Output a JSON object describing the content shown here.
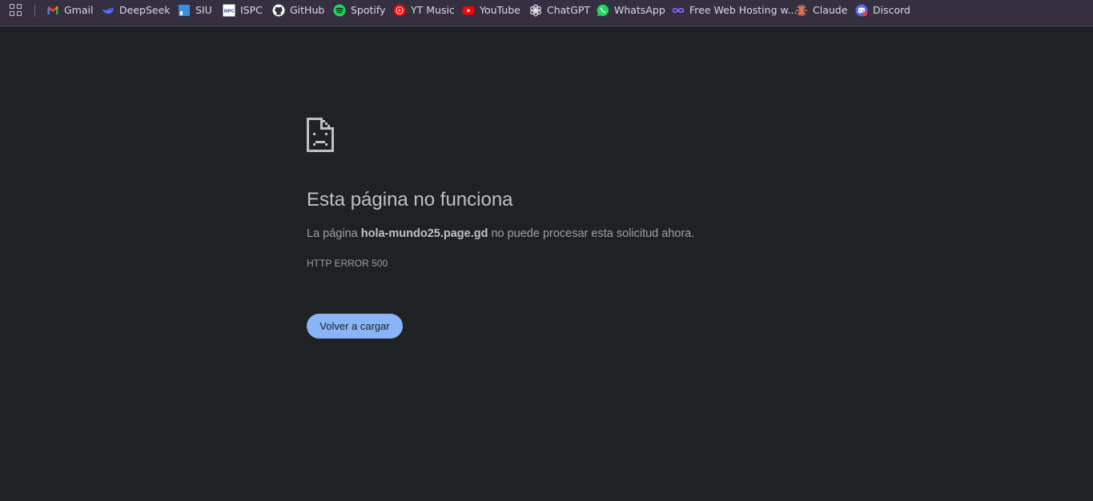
{
  "bookmarks": [
    {
      "label": "Gmail",
      "icon": "gmail-icon"
    },
    {
      "label": "DeepSeek",
      "icon": "deepseek-icon"
    },
    {
      "label": "SIU",
      "icon": "siu-icon"
    },
    {
      "label": "ISPC",
      "icon": "ispc-icon"
    },
    {
      "label": "GitHub",
      "icon": "github-icon"
    },
    {
      "label": "Spotify",
      "icon": "spotify-icon"
    },
    {
      "label": "YT Music",
      "icon": "yt-music-icon"
    },
    {
      "label": "YouTube",
      "icon": "youtube-icon"
    },
    {
      "label": "ChatGPT",
      "icon": "chatgpt-icon"
    },
    {
      "label": "WhatsApp",
      "icon": "whatsapp-icon"
    },
    {
      "label": "Free Web Hosting w...",
      "icon": "free-hosting-icon"
    },
    {
      "label": "Claude",
      "icon": "claude-icon"
    },
    {
      "label": "Discord",
      "icon": "discord-icon"
    }
  ],
  "ispc_icon_text": "ISPC",
  "error": {
    "title": "Esta página no funciona",
    "desc_prefix": "La página ",
    "host": "hola-mundo25.page.gd",
    "desc_suffix": " no puede procesar esta solicitud ahora.",
    "code": "HTTP ERROR 500",
    "reload_label": "Volver a cargar"
  },
  "colors": {
    "page_background": "#202124",
    "bookmarks_bar": "#35303f",
    "title_text": "#bdc1c6",
    "body_text": "#9aa0a6",
    "button": "#8ab4f8"
  }
}
